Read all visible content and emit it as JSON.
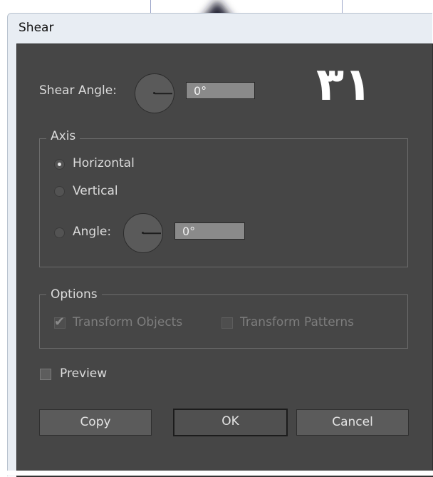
{
  "window": {
    "title": "Shear"
  },
  "shear_angle": {
    "label": "Shear Angle:",
    "value": "0°"
  },
  "overlay_text": "٣١",
  "axis": {
    "title": "Axis",
    "options": [
      {
        "label": "Horizontal",
        "selected": true
      },
      {
        "label": "Vertical",
        "selected": false
      },
      {
        "label": "Angle:",
        "selected": false
      }
    ],
    "angle_value": "0°"
  },
  "options": {
    "title": "Options",
    "transform_objects": {
      "label": "Transform Objects",
      "checked": true,
      "enabled": false
    },
    "transform_patterns": {
      "label": "Transform Patterns",
      "checked": false,
      "enabled": false
    }
  },
  "preview": {
    "label": "Preview",
    "checked": false
  },
  "buttons": {
    "copy": "Copy",
    "ok": "OK",
    "cancel": "Cancel"
  },
  "colors": {
    "dialog_bg": "#464646",
    "field_bg": "#8a8a8a",
    "text": "#dcdcdc"
  }
}
